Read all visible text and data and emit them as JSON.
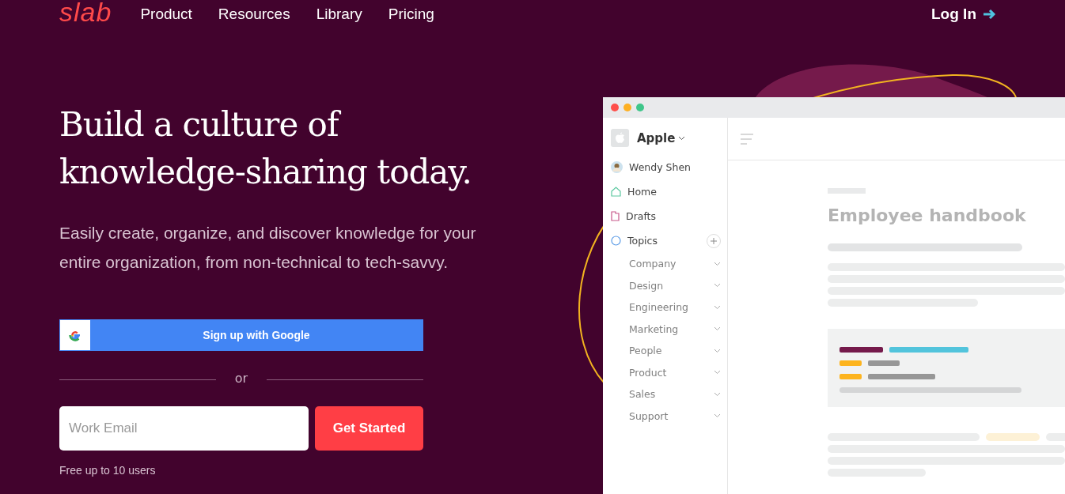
{
  "nav": {
    "logo": "slab",
    "links": [
      "Product",
      "Resources",
      "Library",
      "Pricing"
    ],
    "login": "Log In"
  },
  "hero": {
    "title": "Build a culture of knowledge-sharing today.",
    "subtitle": "Easily create, organize, and discover knowledge for your entire organization, from non-technical to tech-savvy.",
    "google_button": "Sign up with Google",
    "divider": "or",
    "email": {
      "placeholder": "Work Email"
    },
    "cta": "Get Started",
    "note": "Free up to 10 users"
  },
  "app": {
    "workspace": "Apple",
    "user": "Wendy Shen",
    "items": [
      {
        "kind": "home",
        "label": "Home"
      },
      {
        "kind": "drafts",
        "label": "Drafts"
      },
      {
        "kind": "topics",
        "label": "Topics",
        "children": [
          {
            "label": "Company"
          },
          {
            "label": "Design"
          },
          {
            "label": "Engineering"
          },
          {
            "label": "Marketing"
          },
          {
            "label": "People"
          },
          {
            "label": "Product"
          },
          {
            "label": "Sales"
          },
          {
            "label": "Support"
          }
        ]
      }
    ],
    "doc_title": "Employee handbook"
  }
}
